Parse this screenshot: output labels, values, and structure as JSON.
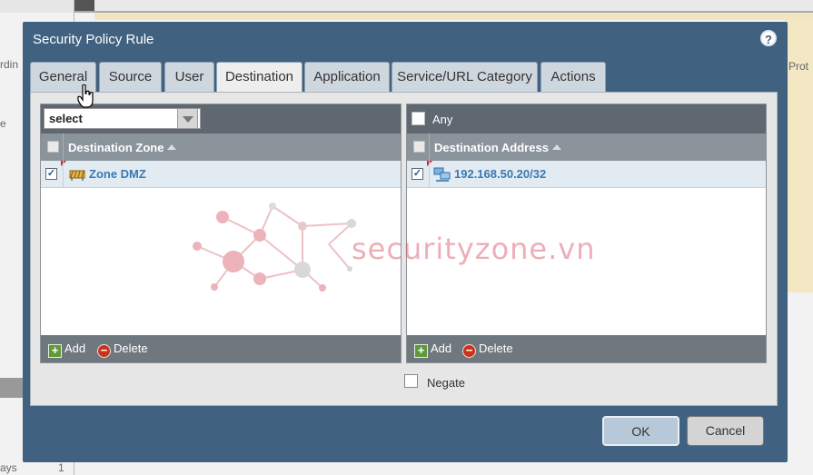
{
  "background": {
    "left_texts": [
      "rdin",
      "e",
      "ays"
    ],
    "left_count": "1",
    "right_text": "? Prot"
  },
  "dialog": {
    "title": "Security Policy Rule",
    "help_icon": "question-circle-icon",
    "tabs": [
      {
        "label": "General",
        "active": false
      },
      {
        "label": "Source",
        "active": false
      },
      {
        "label": "User",
        "active": false
      },
      {
        "label": "Destination",
        "active": true
      },
      {
        "label": "Application",
        "active": false
      },
      {
        "label": "Service/URL Category",
        "active": false
      },
      {
        "label": "Actions",
        "active": false
      }
    ],
    "zone_panel": {
      "select_value": "select",
      "header": "Destination Zone",
      "rows": [
        {
          "checked": true,
          "icon": "zone-icon",
          "label": "Zone DMZ"
        }
      ],
      "add_label": "Add",
      "delete_label": "Delete"
    },
    "address_panel": {
      "any_label": "Any",
      "any_checked": false,
      "header": "Destination Address",
      "rows": [
        {
          "checked": true,
          "icon": "network-address-icon",
          "label": "192.168.50.20/32"
        }
      ],
      "add_label": "Add",
      "delete_label": "Delete"
    },
    "negate_label": "Negate",
    "negate_checked": false,
    "ok_label": "OK",
    "cancel_label": "Cancel"
  },
  "watermark": {
    "text": "securityzone.vn"
  },
  "colors": {
    "dialog_bg": "#40617f",
    "link_text": "#3b78b0",
    "toolbar_dark": "#5f6770",
    "header_gray": "#8b939b"
  }
}
